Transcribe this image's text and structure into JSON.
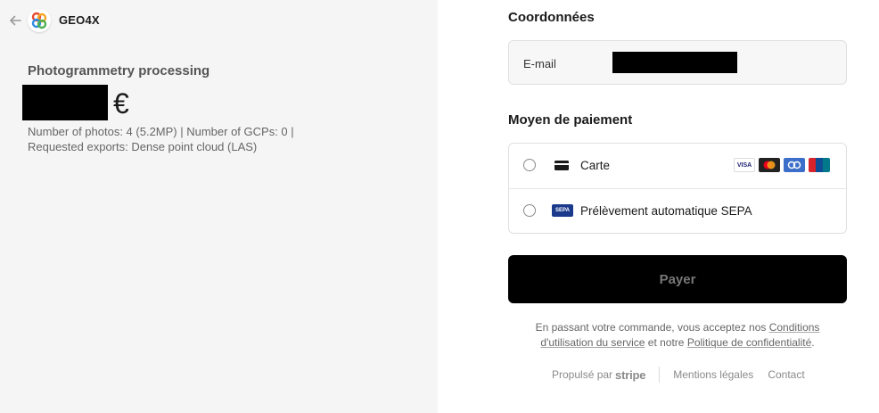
{
  "merchant": {
    "name": "GEO4X",
    "logo_icon": "geo4x-logo-icon",
    "back_icon": "arrow-left-icon"
  },
  "product": {
    "name": "Photogrammetry processing",
    "currency_symbol": "€",
    "description_line1": "Number of photos: 4 (5.2MP) | Number of GCPs: 0 |",
    "description_line2": "Requested exports: Dense point cloud (LAS)"
  },
  "contact": {
    "section_title": "Coordonnées",
    "email_label": "E-mail"
  },
  "payment": {
    "section_title": "Moyen de paiement",
    "methods": [
      {
        "label": "Carte",
        "icon": "card-icon",
        "brands": [
          "VISA",
          "MC",
          "JCB",
          "UnionPay"
        ]
      },
      {
        "label": "Prélèvement automatique SEPA",
        "icon": "sepa-icon",
        "icon_text": "SEPA"
      }
    ]
  },
  "pay_button": {
    "label": "Payer"
  },
  "legal": {
    "prefix": "En passant votre commande, vous acceptez nos ",
    "terms_link": "Conditions d'utilisation du service",
    "middle": " et notre ",
    "privacy_link": "Politique de confidentialité",
    "suffix": "."
  },
  "footer": {
    "powered_by": "Propulsé par",
    "stripe": "stripe",
    "legal_link": "Mentions légales",
    "contact_link": "Contact"
  },
  "colors": {
    "left_bg": "#f5f5f5",
    "button_bg": "#000000",
    "button_text": "#777777"
  }
}
